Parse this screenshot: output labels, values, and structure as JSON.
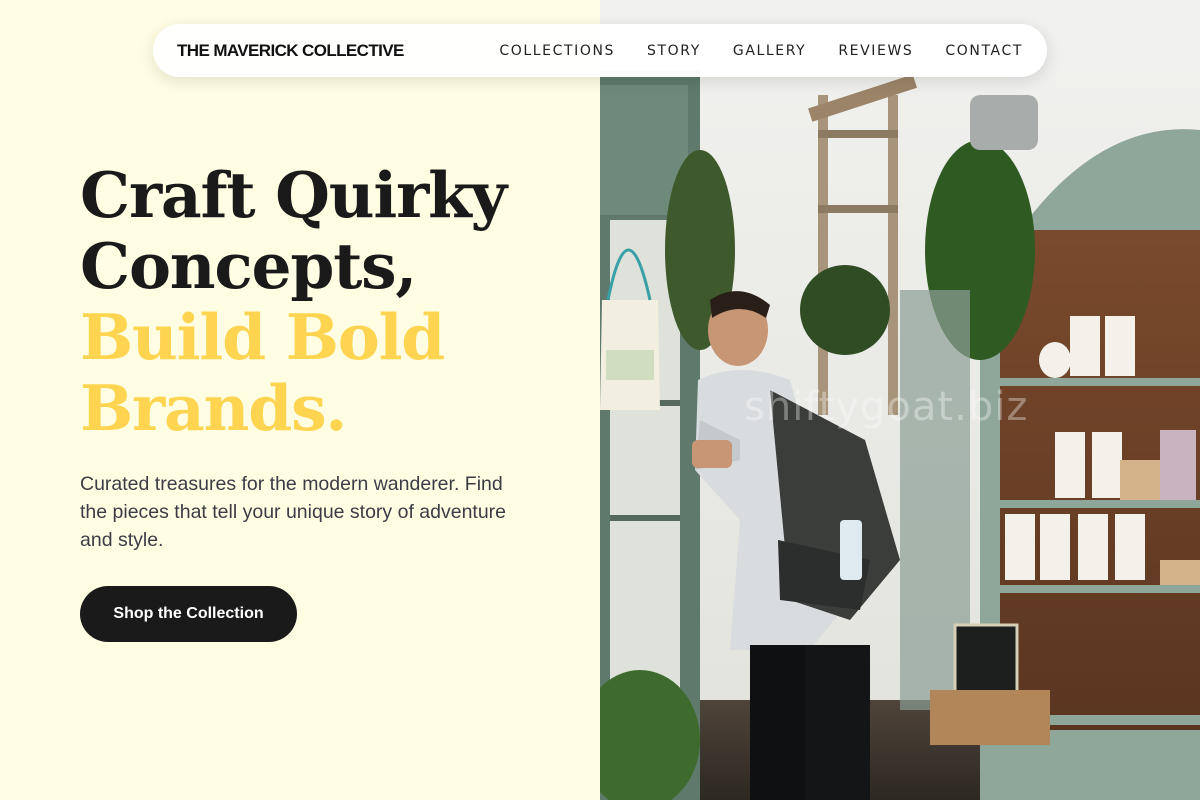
{
  "nav": {
    "brand": "THE MAVERICK COLLECTIVE",
    "links": [
      "COLLECTIONS",
      "STORY",
      "GALLERY",
      "REVIEWS",
      "CONTACT"
    ]
  },
  "hero": {
    "headline_line1": "Craft Quirky",
    "headline_line2": "Concepts,",
    "headline_line3": "Build Bold",
    "headline_line4": "Brands.",
    "subtext": "Curated treasures for the modern wanderer. Find the pieces that tell your unique story of adventure and style.",
    "cta_label": "Shop the Collection"
  },
  "image": {
    "watermark": "shiftygoat.biz"
  },
  "colors": {
    "background": "#fffee3",
    "accent": "#ffd451",
    "dark": "#1a1a1a"
  }
}
